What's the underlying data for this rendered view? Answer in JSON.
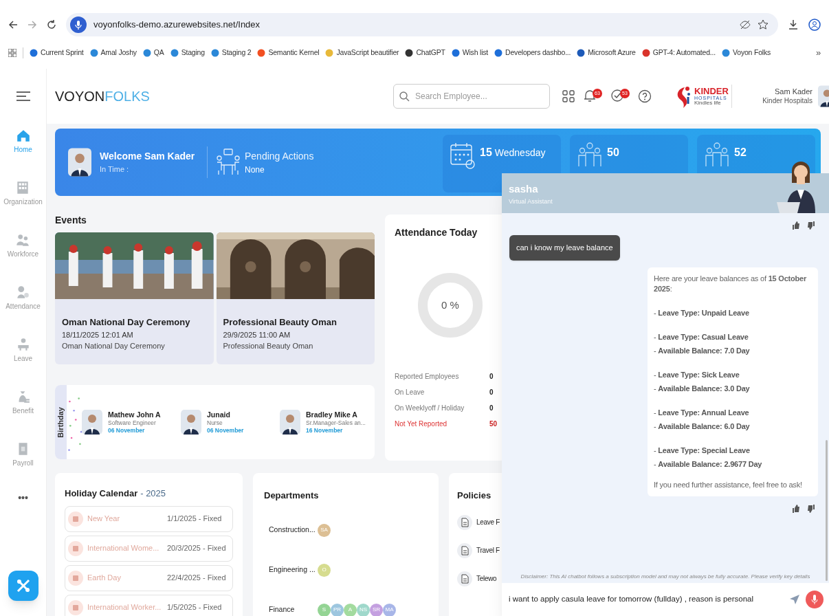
{
  "browser": {
    "url": "voyonfolks-demo.azurewebsites.net/Index",
    "bookmarks": [
      {
        "label": "Current Sprint",
        "color": "#1e6fd9"
      },
      {
        "label": "Amal Joshy",
        "color": "#2b88d8"
      },
      {
        "label": "QA",
        "color": "#2b88d8"
      },
      {
        "label": "Staging",
        "color": "#2b88d8"
      },
      {
        "label": "Staging 2",
        "color": "#2b88d8"
      },
      {
        "label": "Semantic Kernel",
        "color": "#f25022"
      },
      {
        "label": "JavaScript beautifier",
        "color": "#e8b93a"
      },
      {
        "label": "ChatGPT",
        "color": "#333333"
      },
      {
        "label": "Wish list",
        "color": "#1e6fd9"
      },
      {
        "label": "Developers dashbo...",
        "color": "#1e6fd9"
      },
      {
        "label": "Microsoft Azure",
        "color": "#1e5ab8"
      },
      {
        "label": "GPT-4: Automated...",
        "color": "#d9342b"
      },
      {
        "label": "Voyon Folks",
        "color": "#2b88d8"
      }
    ],
    "more": "»"
  },
  "header": {
    "logo": [
      "VOYON",
      "FOLKS"
    ],
    "search": {
      "placeholder": "Search Employee..."
    },
    "notifications": "63",
    "approvals": "53",
    "company_logo": {
      "name": "KINDER",
      "sub": "HOSPITALS",
      "tagline": "Kindles life"
    },
    "user": {
      "name": "Sam Kader",
      "company": "Kinder Hospitals"
    }
  },
  "sidebar": {
    "items": [
      {
        "label": "Home",
        "selected": true
      },
      {
        "label": "Organization",
        "selected": false
      },
      {
        "label": "Workforce",
        "selected": false
      },
      {
        "label": "Attendance",
        "selected": false
      },
      {
        "label": "Leave",
        "selected": false
      },
      {
        "label": "Benefit",
        "selected": false
      },
      {
        "label": "Payroll",
        "selected": false
      }
    ],
    "more": "•••"
  },
  "banner": {
    "welcome": "Welcome Sam Kader",
    "in_time": "In Time :",
    "pending_title": "Pending Actions",
    "pending_value": "None",
    "cards": [
      {
        "value": "15",
        "label": "Wednesday"
      },
      {
        "value": "50"
      },
      {
        "value": "52"
      }
    ]
  },
  "events": {
    "title": "Events",
    "items": [
      {
        "title": "Oman National Day Ceremony",
        "date": "18/11/2025 12:01 AM",
        "description": "Oman National Day Ceremony"
      },
      {
        "title": "Professional Beauty Oman",
        "date": "29/9/2025 11:00 AM",
        "description": "Professional Beauty Oman"
      }
    ]
  },
  "birthday": {
    "title": "Birthday",
    "people": [
      {
        "name": "Mathew John A",
        "role": "Software Engineer",
        "date": "06 November"
      },
      {
        "name": "Junaid",
        "role": "Nurse",
        "date": "06 November"
      },
      {
        "name": "Bradley Mike A",
        "role": "Sr.Manager-Sales an...",
        "date": "16 November"
      }
    ]
  },
  "attendance": {
    "title": "Attendance Today",
    "donut": {
      "label": "0 %",
      "level": 0
    },
    "rows": [
      {
        "label": "Reported Employees",
        "value": "0",
        "alert": false
      },
      {
        "label": "On Leave",
        "value": "0",
        "alert": false
      },
      {
        "label": "On Weeklyoff / Holiday",
        "value": "0",
        "alert": false
      },
      {
        "label": "Not Yet Reported",
        "value": "50",
        "alert": true
      }
    ]
  },
  "holidays": {
    "title": "Holiday Calendar",
    "year": "- 2025",
    "items": [
      {
        "name": "New Year",
        "date": "1/1/2025 - Fixed"
      },
      {
        "name": "International Wome...",
        "date": "20/3/2025 - Fixed"
      },
      {
        "name": "Earth Day",
        "date": "22/4/2025 - Fixed"
      },
      {
        "name": "International Worker...",
        "date": "1/5/2025 - Fixed"
      }
    ]
  },
  "departments": {
    "title": "Departments",
    "items": [
      {
        "name": "Construction...",
        "members": [
          {
            "initials": "SA",
            "color": "#dcbf94"
          }
        ]
      },
      {
        "name": "Engineering ...",
        "members": [
          {
            "initials": "O",
            "color": "#d6dc8f"
          }
        ]
      },
      {
        "name": "Finance",
        "members": [
          {
            "initials": "S",
            "color": "#94d494"
          },
          {
            "initials": "PR",
            "color": "#9dc6df"
          },
          {
            "initials": "A",
            "color": "#a3db9f"
          },
          {
            "initials": "NS",
            "color": "#9fd8cb"
          },
          {
            "initials": "SR",
            "color": "#c4a0e0"
          },
          {
            "initials": "MA",
            "color": "#a8b6e8"
          }
        ]
      }
    ]
  },
  "policies": {
    "title": "Policies",
    "items": [
      "Leave F",
      "Travel F",
      "Telewo"
    ]
  },
  "chat": {
    "name": "sasha",
    "role": "Virtual Assistant",
    "user_message": "can i know my leave balance",
    "reply": {
      "intro": "Here are your leave balances as of **15 October 2025**:",
      "groups": [
        [
          "- **Leave Type: Unpaid Leave**"
        ],
        [
          "- **Leave Type: Casual Leave**",
          "- **Available Balance: 7.0 Day**"
        ],
        [
          "- **Leave Type: Sick Leave**",
          "- **Available Balance: 3.0 Day**"
        ],
        [
          "- **Leave Type: Annual Leave**",
          "- **Available Balance: 6.0 Day**"
        ],
        [
          "- **Leave Type: Special Leave**",
          "- **Available Balance: 2.9677 Day**"
        ]
      ],
      "outro": "If you need further assistance, feel free to ask!"
    },
    "disclaimer": "Disclaimer: This AI chatbot follows a subscription model and may not always be fully accurate. Please verify key details",
    "input": "i want to apply casula leave for tomorrow (fullday) , reason is personal"
  }
}
